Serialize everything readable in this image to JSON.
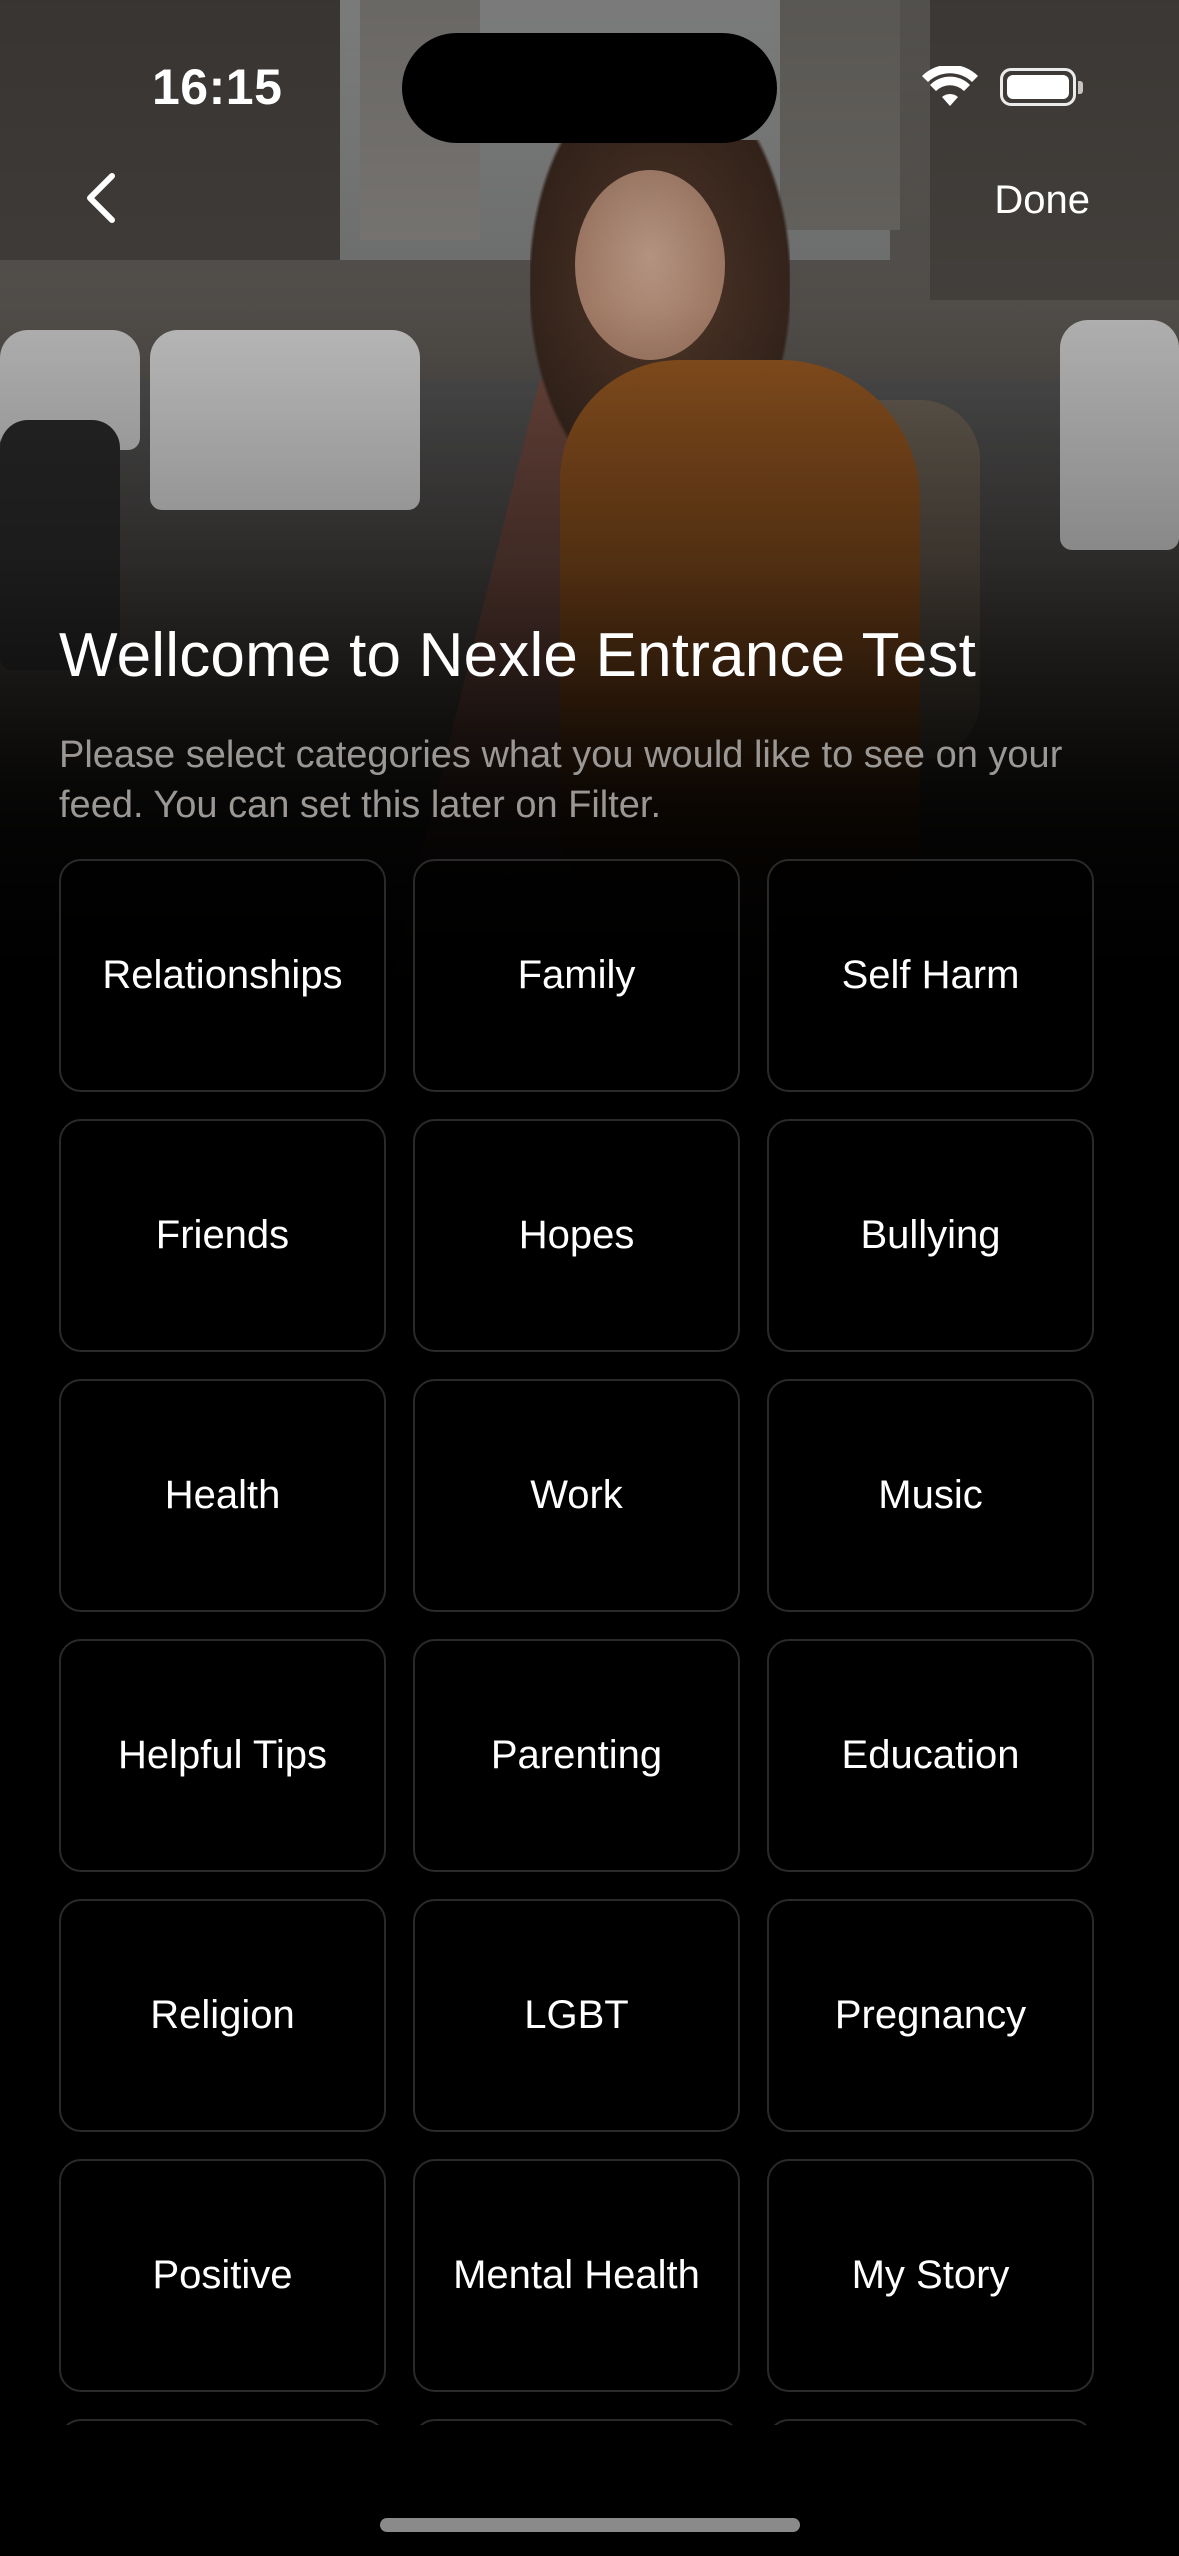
{
  "status_bar": {
    "time": "16:15",
    "wifi_icon": "wifi-icon",
    "battery_icon": "battery-icon"
  },
  "nav": {
    "back_icon": "chevron-left-icon",
    "done_label": "Done"
  },
  "header": {
    "title": "Wellcome to Nexle Entrance Test",
    "subtitle": "Please select categories what you would like to see on your feed. You can set this later on Filter."
  },
  "categories": [
    "Relationships",
    "Family",
    "Self Harm",
    "Friends",
    "Hopes",
    "Bullying",
    "Health",
    "Work",
    "Music",
    "Helpful Tips",
    "Parenting",
    "Education",
    "Religion",
    "LGBT",
    "Pregnancy",
    "Positive",
    "Mental Health",
    "My Story",
    "",
    "",
    ""
  ],
  "colors": {
    "background": "#000000",
    "tile_border": "#2a2a2a",
    "subtitle": "#9a9794",
    "home_indicator": "#8a8a8a"
  }
}
